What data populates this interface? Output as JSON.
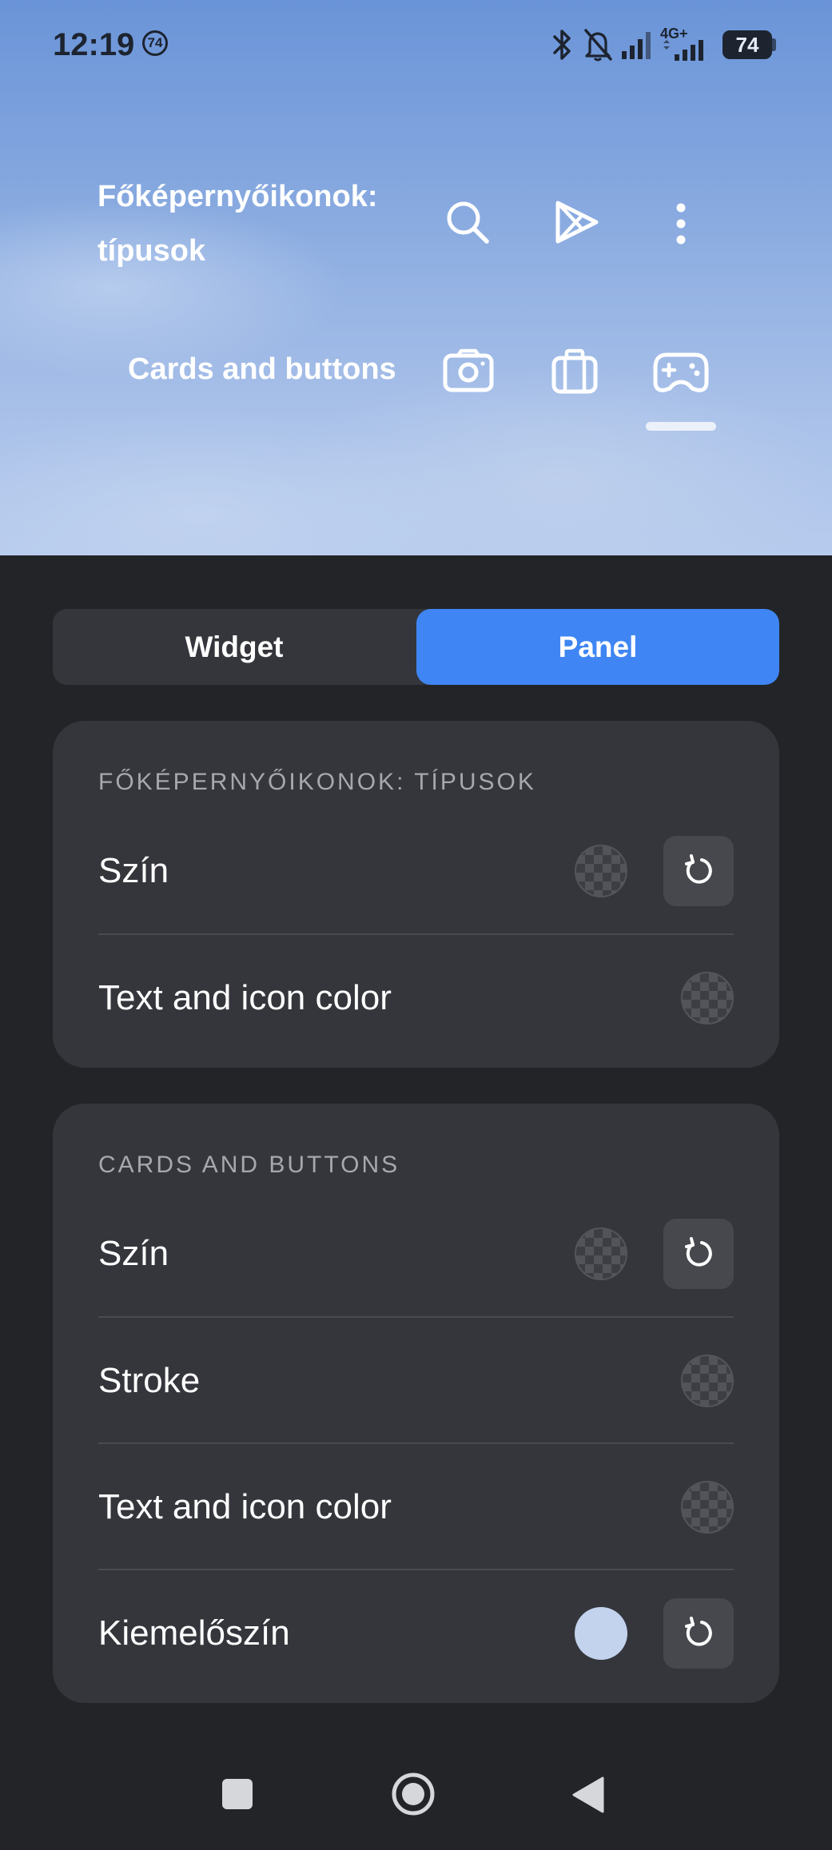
{
  "status_bar": {
    "time": "12:19",
    "notification_badge": "74",
    "network": "4G+",
    "battery": "74",
    "icons": [
      "bluetooth-icon",
      "bell-off-icon",
      "signal-icon",
      "signal-4g-icon"
    ]
  },
  "preview": {
    "title": "Főképernyőikonok: típusok",
    "toolbar_icons": [
      "search-icon",
      "play-store-icon",
      "more-vert-icon"
    ],
    "cards_label": "Cards and buttons",
    "card_icons": [
      "camera-icon",
      "briefcase-icon",
      "gamepad-icon"
    ],
    "selected_card_icon": "gamepad-icon"
  },
  "tabs": {
    "widget": "Widget",
    "panel": "Panel",
    "selected": "Panel"
  },
  "sections": [
    {
      "title": "FŐKÉPERNYŐIKONOK: TÍPUSOK",
      "rows": [
        {
          "label": "Szín",
          "swatch": "transparent",
          "reset": true
        },
        {
          "label": "Text and icon color",
          "swatch": "transparent",
          "reset": false
        }
      ]
    },
    {
      "title": "CARDS AND BUTTONS",
      "rows": [
        {
          "label": "Szín",
          "swatch": "transparent",
          "reset": true
        },
        {
          "label": "Stroke",
          "swatch": "transparent",
          "reset": false
        },
        {
          "label": "Text and icon color",
          "swatch": "transparent",
          "reset": false
        },
        {
          "label": "Kiemelőszín",
          "swatch": "#c3d3ee",
          "reset": true
        }
      ]
    }
  ],
  "colors": {
    "background": "#232428",
    "card": "#35363c",
    "accent": "#3f86f4",
    "highlight_swatch": "#c3d3ee"
  },
  "nav_bar": [
    "recents-square-icon",
    "home-circle-icon",
    "back-triangle-icon"
  ]
}
